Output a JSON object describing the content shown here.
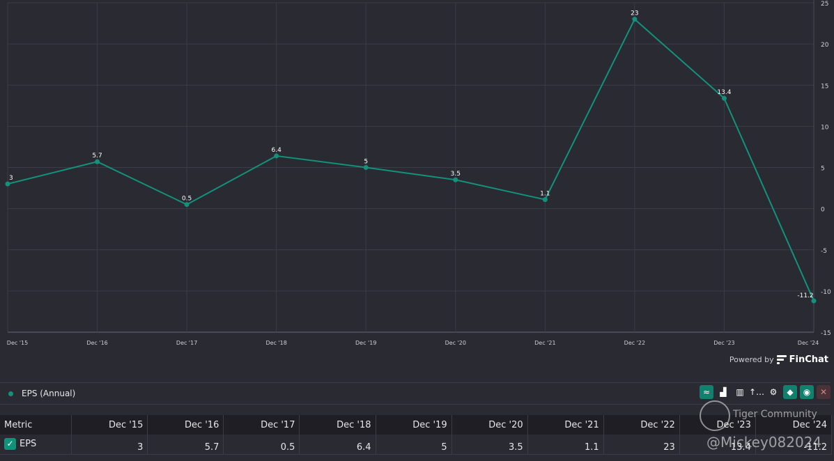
{
  "chart_data": {
    "type": "line",
    "title": "EPS (Annual)",
    "categories": [
      "Dec '15",
      "Dec '16",
      "Dec '17",
      "Dec '18",
      "Dec '19",
      "Dec '20",
      "Dec '21",
      "Dec '22",
      "Dec '23",
      "Dec '24"
    ],
    "series": [
      {
        "name": "EPS (Annual)",
        "values": [
          3,
          5.7,
          0.5,
          6.4,
          5,
          3.5,
          1.1,
          23,
          13.4,
          -11.2
        ]
      }
    ],
    "yticks": [
      25,
      20,
      15,
      10,
      5,
      0,
      -5,
      -10,
      -15
    ],
    "ylim": [
      -15,
      25
    ],
    "grid": true,
    "color": "#12927a"
  },
  "powered": {
    "prefix": "Powered by",
    "brand": "FinChat"
  },
  "legend": {
    "label": "EPS (Annual)"
  },
  "toolbar": [
    {
      "icon": "line-chart-icon",
      "glyph": "≈",
      "active": true
    },
    {
      "icon": "bar-chart-icon",
      "glyph": "▟",
      "active": false
    },
    {
      "icon": "stacked-bar-icon",
      "glyph": "▥",
      "active": false
    },
    {
      "icon": "sort-icon",
      "glyph": "↑…",
      "active": false
    },
    {
      "icon": "gear-icon",
      "glyph": "⚙",
      "active": false
    },
    {
      "icon": "tag-icon",
      "glyph": "◆",
      "active": true
    },
    {
      "icon": "eye-icon",
      "glyph": "◉",
      "active": true
    },
    {
      "icon": "close-icon",
      "glyph": "✕",
      "active": false
    }
  ],
  "table": {
    "header": "Metric",
    "columns": [
      "Dec '15",
      "Dec '16",
      "Dec '17",
      "Dec '18",
      "Dec '19",
      "Dec '20",
      "Dec '21",
      "Dec '22",
      "Dec '23",
      "Dec '24"
    ],
    "rows": [
      {
        "metric": "EPS",
        "values": [
          "3",
          "5.7",
          "0.5",
          "6.4",
          "5",
          "3.5",
          "1.1",
          "23",
          "13.4",
          "-11.2"
        ]
      }
    ]
  },
  "watermark": {
    "community": "Tiger Community",
    "user": "@Mickey082024"
  }
}
